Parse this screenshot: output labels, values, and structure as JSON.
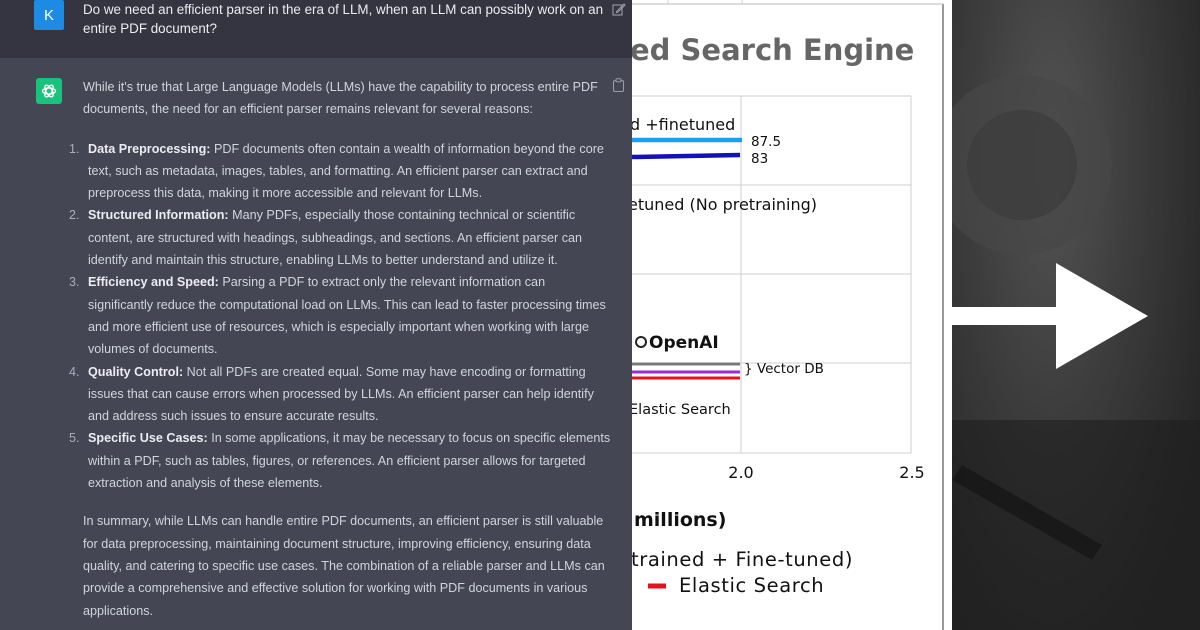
{
  "chat": {
    "user_initial": "K",
    "question": "Do we need an efficient parser in the era of LLM, when an LLM can possibly work on an entire PDF document?",
    "intro": "While it's true that Large Language Models (LLMs) have the capability to process entire PDF documents, the need for an efficient parser remains relevant for several reasons:",
    "points": [
      {
        "num": "1.",
        "title": "Data Preprocessing:",
        "text": " PDF documents often contain a wealth of information beyond the core text, such as metadata, images, tables, and formatting. An efficient parser can extract and preprocess this data, making it more accessible and relevant for LLMs."
      },
      {
        "num": "2.",
        "title": "Structured Information:",
        "text": " Many PDFs, especially those containing technical or scientific content, are structured with headings, subheadings, and sections. An efficient parser can identify and maintain this structure, enabling LLMs to better understand and utilize it."
      },
      {
        "num": "3.",
        "title": "Efficiency and Speed:",
        "text": " Parsing a PDF to extract only the relevant information can significantly reduce the computational load on LLMs. This can lead to faster processing times and more efficient use of resources, which is especially important when working with large volumes of documents."
      },
      {
        "num": "4.",
        "title": "Quality Control:",
        "text": " Not all PDFs are created equal. Some may have encoding or formatting issues that can cause errors when processed by LLMs. An efficient parser can help identify and address such issues to ensure accurate results."
      },
      {
        "num": "5.",
        "title": "Specific Use Cases:",
        "text": " In some applications, it may be necessary to focus on specific elements within a PDF, such as tables, figures, or references. An efficient parser allows for targeted extraction and analysis of these elements."
      }
    ],
    "summary": "In summary, while LLMs can handle entire PDF documents, an efficient parser is still valuable for data preprocessing, maintaining document structure, improving efficiency, ensuring data quality, and catering to specific use cases. The combination of a reliable parser and LLMs can provide a comprehensive and effective solution for working with PDF documents in various applications."
  },
  "chart": {
    "title": "ed Search Engine",
    "row_labels": [
      "d +finetuned",
      "etuned (No pretraining)",
      "OpenAI",
      "Elastic Search"
    ],
    "value_labels": [
      "87.5",
      "83"
    ],
    "vector_db_label": "} Vector DB",
    "x_ticks": [
      "2.0",
      "2.5"
    ],
    "x_axis_label": "millions)",
    "legend": [
      "trained + Fine-tuned)",
      "Elastic Search"
    ]
  },
  "chart_data": {
    "type": "bar",
    "orientation": "horizontal",
    "title": "ed Search Engine",
    "xlabel": "millions)",
    "x_ticks": [
      2.0,
      2.5
    ],
    "grid": true,
    "series": [
      {
        "name": "d +finetuned",
        "values": [
          87.5
        ],
        "color": "#1aa0ee"
      },
      {
        "name": "d +finetuned",
        "values": [
          83
        ],
        "color": "#1212b8"
      }
    ],
    "colors": {
      "light_blue": "#1aa0ee",
      "dark_blue": "#1212b8",
      "gray": "#7a7a7a",
      "purple": "#9c2bd6",
      "red": "#e0141a"
    }
  }
}
